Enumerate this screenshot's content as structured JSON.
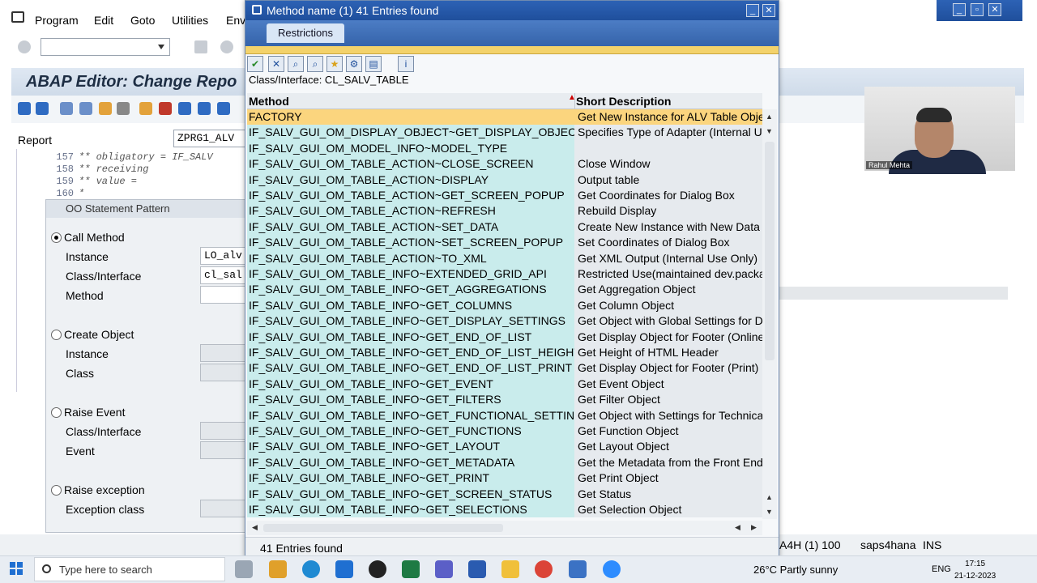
{
  "main": {
    "menu": [
      "Program",
      "Edit",
      "Goto",
      "Utilities",
      "Env"
    ],
    "title": "ABAP Editor: Change Repo",
    "report_label": "Report",
    "report_value": "ZPRG1_ALV",
    "code_lines": [
      {
        "num": "157",
        "text": "**    obligatory = IF_SALV"
      },
      {
        "num": "158",
        "text": "**  receiving"
      },
      {
        "num": "159",
        "text": "**    value      ="
      },
      {
        "num": "160",
        "text": "*"
      }
    ],
    "status": {
      "system": "A4H (1) 100",
      "host": "saps4hana",
      "mode": "INS"
    }
  },
  "oo_dialog": {
    "title": "OO Statement Pattern",
    "call_method": "Call Method",
    "instance_label": "Instance",
    "instance_value": "LO_alv",
    "class_label": "Class/Interface",
    "class_value": "cl_sal",
    "method_label": "Method",
    "create_object": "Create Object",
    "co_instance_label": "Instance",
    "co_class_label": "Class",
    "raise_event": "Raise Event",
    "re_class_label": "Class/Interface",
    "re_event_label": "Event",
    "raise_exception": "Raise exception",
    "exception_class_label": "Exception class"
  },
  "f4_dialog": {
    "title": "Method name (1)   41 Entries found",
    "tab": "Restrictions",
    "class_line": "Class/Interface: CL_SALV_TABLE",
    "col_method": "Method",
    "col_desc": "Short Description",
    "status": "41 Entries found",
    "rows": [
      {
        "m": "FACTORY",
        "d": "Get New Instance for ALV Table Object"
      },
      {
        "m": "IF_SALV_GUI_OM_DISPLAY_OBJECT~GET_DISPLAY_OBJECT_TYPE",
        "d": "Specifies Type of Adapter (Internal Us"
      },
      {
        "m": "IF_SALV_GUI_OM_MODEL_INFO~MODEL_TYPE",
        "d": ""
      },
      {
        "m": "IF_SALV_GUI_OM_TABLE_ACTION~CLOSE_SCREEN",
        "d": "Close Window"
      },
      {
        "m": "IF_SALV_GUI_OM_TABLE_ACTION~DISPLAY",
        "d": "Output table"
      },
      {
        "m": "IF_SALV_GUI_OM_TABLE_ACTION~GET_SCREEN_POPUP",
        "d": "Get Coordinates for Dialog Box"
      },
      {
        "m": "IF_SALV_GUI_OM_TABLE_ACTION~REFRESH",
        "d": "Rebuild Display"
      },
      {
        "m": "IF_SALV_GUI_OM_TABLE_ACTION~SET_DATA",
        "d": "Create New Instance with New Data S"
      },
      {
        "m": "IF_SALV_GUI_OM_TABLE_ACTION~SET_SCREEN_POPUP",
        "d": "Set Coordinates of Dialog Box"
      },
      {
        "m": "IF_SALV_GUI_OM_TABLE_ACTION~TO_XML",
        "d": "Get XML Output (Internal Use Only)"
      },
      {
        "m": "IF_SALV_GUI_OM_TABLE_INFO~EXTENDED_GRID_API",
        "d": "Restricted Use(maintained dev.packag"
      },
      {
        "m": "IF_SALV_GUI_OM_TABLE_INFO~GET_AGGREGATIONS",
        "d": "Get Aggregation Object"
      },
      {
        "m": "IF_SALV_GUI_OM_TABLE_INFO~GET_COLUMNS",
        "d": "Get Column Object"
      },
      {
        "m": "IF_SALV_GUI_OM_TABLE_INFO~GET_DISPLAY_SETTINGS",
        "d": "Get Object with Global Settings for Dis"
      },
      {
        "m": "IF_SALV_GUI_OM_TABLE_INFO~GET_END_OF_LIST",
        "d": "Get Display Object for Footer (Online)"
      },
      {
        "m": "IF_SALV_GUI_OM_TABLE_INFO~GET_END_OF_LIST_HEIGHT",
        "d": "Get Height of HTML Header"
      },
      {
        "m": "IF_SALV_GUI_OM_TABLE_INFO~GET_END_OF_LIST_PRINT",
        "d": "Get Display Object for Footer (Print)"
      },
      {
        "m": "IF_SALV_GUI_OM_TABLE_INFO~GET_EVENT",
        "d": "Get Event Object"
      },
      {
        "m": "IF_SALV_GUI_OM_TABLE_INFO~GET_FILTERS",
        "d": "Get Filter Object"
      },
      {
        "m": "IF_SALV_GUI_OM_TABLE_INFO~GET_FUNCTIONAL_SETTINGS",
        "d": "Get Object with Settings for Technical"
      },
      {
        "m": "IF_SALV_GUI_OM_TABLE_INFO~GET_FUNCTIONS",
        "d": "Get Function Object"
      },
      {
        "m": "IF_SALV_GUI_OM_TABLE_INFO~GET_LAYOUT",
        "d": "Get Layout Object"
      },
      {
        "m": "IF_SALV_GUI_OM_TABLE_INFO~GET_METADATA",
        "d": "Get the Metadata from the Front End i"
      },
      {
        "m": "IF_SALV_GUI_OM_TABLE_INFO~GET_PRINT",
        "d": "Get Print Object"
      },
      {
        "m": "IF_SALV_GUI_OM_TABLE_INFO~GET_SCREEN_STATUS",
        "d": "Get Status"
      },
      {
        "m": "IF_SALV_GUI_OM_TABLE_INFO~GET_SELECTIONS",
        "d": "Get Selection Object"
      }
    ],
    "selected_index": 0
  },
  "webcam": {
    "name": "Rahul Mehta"
  },
  "taskbar": {
    "search_placeholder": "Type here to search",
    "weather": "26°C  Partly sunny",
    "lang": "ENG",
    "time": "17:15",
    "date": "21-12-2023"
  }
}
